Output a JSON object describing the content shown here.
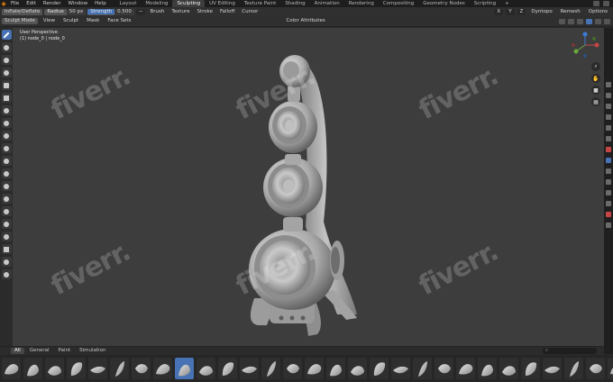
{
  "menubar": {
    "items": [
      "File",
      "Edit",
      "Render",
      "Window",
      "Help"
    ],
    "workspaces": [
      "Layout",
      "Modeling",
      "Sculpting",
      "UV Editing",
      "Texture Paint",
      "Shading",
      "Animation",
      "Rendering",
      "Compositing",
      "Geometry Nodes",
      "Scripting"
    ],
    "active_workspace": "Sculpting",
    "add_tab": "+"
  },
  "tool_header": {
    "brush_name": "Inflate/Deflate",
    "radius_label": "Radius",
    "radius_value": "50 px",
    "strength_label": "Strength",
    "strength_value": "0.500",
    "menus": [
      "Brush",
      "Texture",
      "Stroke",
      "Falloff",
      "Cursor"
    ],
    "symmetry": [
      "X",
      "Y",
      "Z"
    ]
  },
  "view_header": {
    "mode": "Sculpt Mode",
    "menus": [
      "View",
      "Sculpt",
      "Mask",
      "Face Sets"
    ],
    "color_attributes": "Color Attributes",
    "dyntopo": "Dyntopo",
    "remesh": "Remesh",
    "options": "Options"
  },
  "viewport": {
    "perspective_label": "User Perspective",
    "object_label": "(1) node_0 | node_0",
    "watermark_text": "fiverr",
    "watermark_dot": "."
  },
  "asset_shelf": {
    "tabs": [
      "All",
      "General",
      "Paint",
      "Simulation"
    ],
    "active_tab": "All",
    "search_placeholder": "",
    "brush_count": 30,
    "active_brush_index": 8
  },
  "colors": {
    "accent": "#4772b3",
    "viewport_bg": "#3d3d3d",
    "brand_orange": "#e87d0d"
  }
}
